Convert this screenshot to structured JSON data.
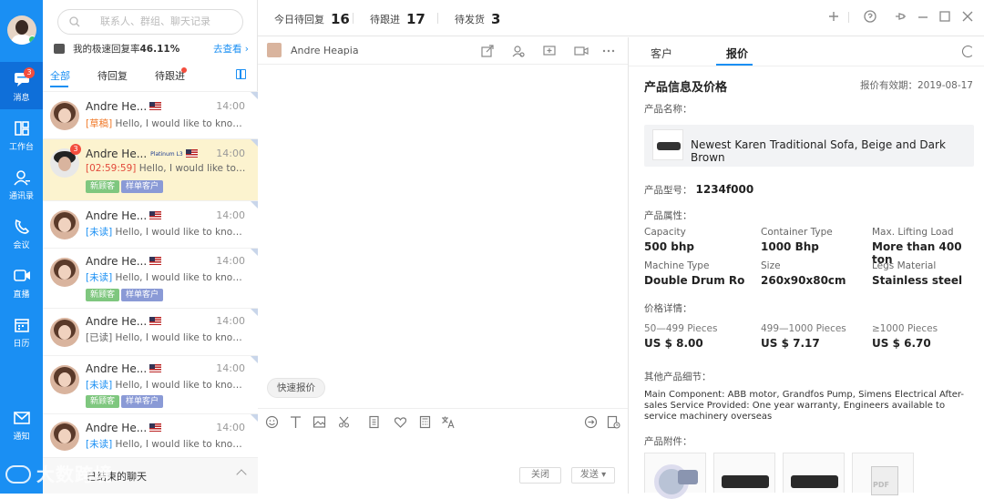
{
  "rail": {
    "items": [
      {
        "label": "消息",
        "badge": "3",
        "icon": "message-icon"
      },
      {
        "label": "工作台",
        "icon": "workbench-icon"
      },
      {
        "label": "通讯录",
        "icon": "contacts-icon"
      },
      {
        "label": "会议",
        "icon": "meeting-icon"
      },
      {
        "label": "直播",
        "icon": "live-icon"
      },
      {
        "label": "日历",
        "icon": "calendar-icon"
      },
      {
        "label": "通知",
        "icon": "notify-icon"
      }
    ]
  },
  "sidebar": {
    "search_placeholder": "联系人、群组、聊天记录",
    "rate_label": "我的极速回复率",
    "rate_value": "46.11%",
    "rate_link": "去查看 ›",
    "tabs": [
      "全部",
      "待回复",
      "待跟进"
    ],
    "conversations": [
      {
        "name": "Andre He...",
        "time": "14:00",
        "tag": "[草稿]",
        "text": " Hello, I would like to know ..."
      },
      {
        "name": "Andre He...",
        "time": "14:00",
        "badge": "3",
        "level": "Platinum L3",
        "tag": "[02:59:59]",
        "text": " Hello, I would like to kn...",
        "chips": [
          "新顾客",
          "样单客户"
        ]
      },
      {
        "name": "Andre He...",
        "time": "14:00",
        "tag": "[未读]",
        "text": " Hello, I would like to know a..."
      },
      {
        "name": "Andre He...",
        "time": "14:00",
        "tag": "[未读]",
        "text": " Hello, I would like to know a...",
        "chips": [
          "新顾客",
          "样单客户"
        ]
      },
      {
        "name": "Andre He...",
        "time": "14:00",
        "tag": "[已读]",
        "text": " Hello, I would like to know a..."
      },
      {
        "name": "Andre He...",
        "time": "14:00",
        "tag": "[未读]",
        "text": " Hello, I would like to know a...",
        "chips": [
          "新顾客",
          "样单客户"
        ]
      },
      {
        "name": "Andre He...",
        "time": "14:00",
        "tag": "[未读]",
        "text": " Hello, I would like to know a..."
      }
    ],
    "footer": "已结束的聊天"
  },
  "watermark": "大数跨境",
  "topbar": {
    "stats": [
      {
        "label": "今日待回复",
        "value": "16"
      },
      {
        "label": "待跟进",
        "value": "17"
      },
      {
        "label": "待发货",
        "value": "3"
      }
    ]
  },
  "chat": {
    "contact_name": "Andre Heapia",
    "quick_quote": "快速报价",
    "close_label": "关闭",
    "send_label": "发送 ▾"
  },
  "panel": {
    "tabs": [
      "客户",
      "报价"
    ],
    "title": "产品信息及价格",
    "validity": "报价有效期：2019-08-17",
    "product_name_label": "产品名称：",
    "product_name": "Newest Karen Traditional Sofa, Beige and Dark Brown",
    "model_label": "产品型号：",
    "model_value": "1234f000",
    "attrs_label": "产品属性：",
    "attrs": [
      {
        "k": "Capacity",
        "v": "500 bhp"
      },
      {
        "k": "Container Type",
        "v": "1000 Bhp"
      },
      {
        "k": "Max. Lifting Load",
        "v": "More than 400 ton"
      },
      {
        "k": "Machine Type",
        "v": "Double Drum Ro"
      },
      {
        "k": "Size",
        "v": "260x90x80cm"
      },
      {
        "k": "Legs Material",
        "v": "Stainless steel"
      }
    ],
    "price_label": "价格详情：",
    "prices": [
      {
        "k": "50—499 Pieces",
        "v": "US $ 8.00"
      },
      {
        "k": "499—1000 Pieces",
        "v": "US $ 7.17"
      },
      {
        "k": "≥1000 Pieces",
        "v": "US $ 6.70"
      }
    ],
    "other_label": "其他产品细节：",
    "other_text": "Main Component: ABB motor, Grandfos Pump, Simens Electrical After-sales Service Provided: One year warranty, Engineers available to service machinery overseas",
    "attach_label": "产品附件：",
    "pdf_text": "PDF"
  }
}
